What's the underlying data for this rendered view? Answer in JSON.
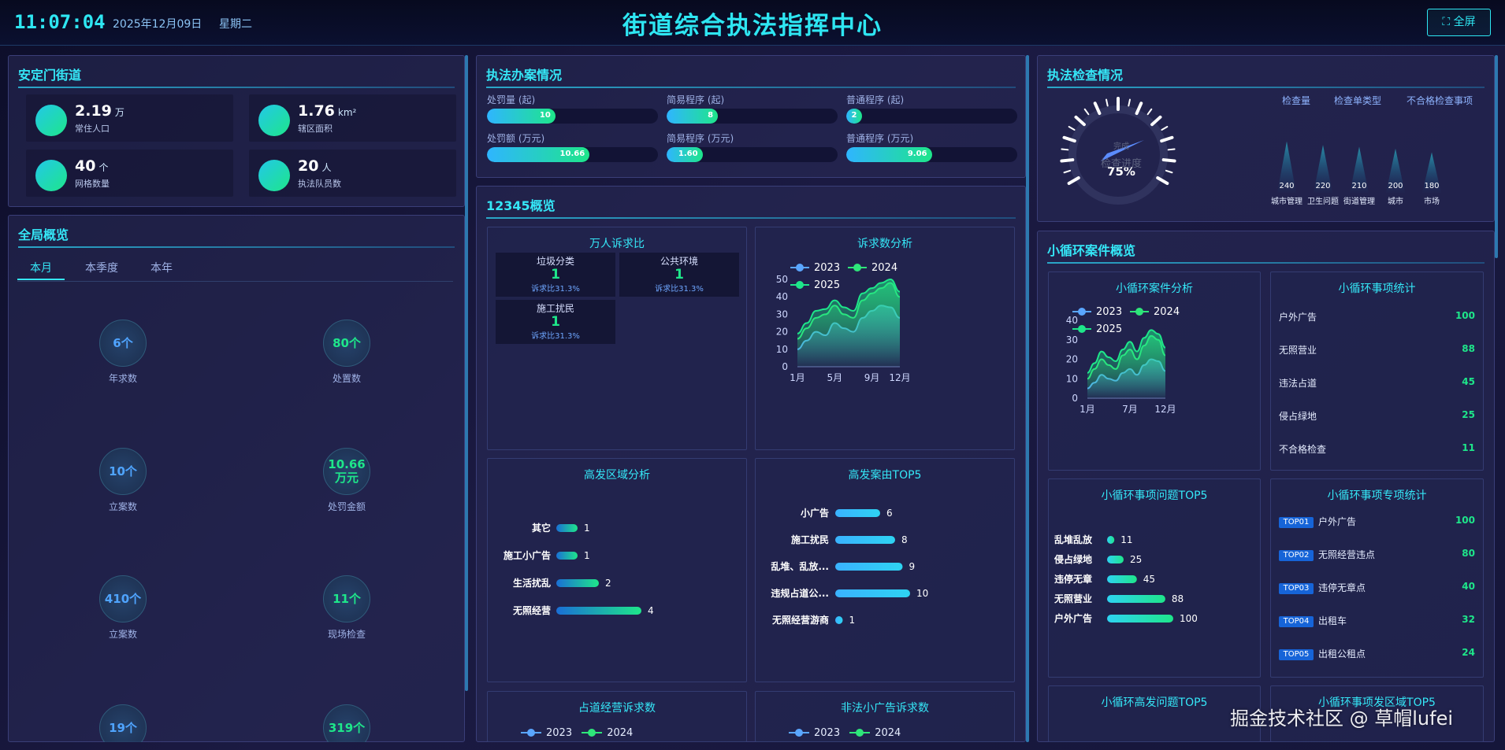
{
  "header": {
    "time": "11:07:04",
    "date": "2025年12月09日",
    "weekday": "星期二",
    "title": "街道综合执法指挥中心",
    "fullscreen_label": "⛶ 全屏"
  },
  "district": {
    "title": "安定门街道",
    "stats": [
      {
        "value": "2.19",
        "unit": "万",
        "label": "常住人口"
      },
      {
        "value": "1.76",
        "unit": "km²",
        "label": "辖区面积"
      },
      {
        "value": "40",
        "unit": "个",
        "label": "网格数量"
      },
      {
        "value": "20",
        "unit": "人",
        "label": "执法队员数"
      }
    ]
  },
  "overview": {
    "title": "全局概览",
    "tabs": [
      "本月",
      "本季度",
      "本年"
    ],
    "items": [
      {
        "value": "6个",
        "label": "年求数",
        "color": "blue"
      },
      {
        "value": "80个",
        "label": "处置数",
        "color": "green"
      },
      {
        "value": "10个",
        "label": "立案数",
        "color": "blue"
      },
      {
        "value": "10.66万元",
        "label": "处罚金额",
        "color": "green"
      },
      {
        "value": "410个",
        "label": "立案数",
        "color": "blue"
      },
      {
        "value": "11个",
        "label": "现场检查",
        "color": "green"
      },
      {
        "value": "19个",
        "label": "",
        "color": "blue"
      },
      {
        "value": "319个",
        "label": "",
        "color": "green"
      }
    ]
  },
  "cases": {
    "title": "执法办案情况",
    "rows": [
      {
        "label": "处罚量 (起)",
        "value": "10",
        "pct": 40
      },
      {
        "label": "简易程序 (起)",
        "value": "8",
        "pct": 30
      },
      {
        "label": "普通程序 (起)",
        "value": "2",
        "pct": 9
      },
      {
        "label": "处罚额 (万元)",
        "value": "10.66",
        "pct": 60
      },
      {
        "label": "简易程序 (万元)",
        "value": "1.60",
        "pct": 21
      },
      {
        "label": "普通程序 (万元)",
        "value": "9.06",
        "pct": 50
      }
    ]
  },
  "hotline": {
    "title": "12345概览",
    "ratio": {
      "title": "万人诉求比",
      "cards": [
        {
          "name": "垃圾分类",
          "value": "1",
          "ratio": "诉求比31.3%"
        },
        {
          "name": "公共环境",
          "value": "1",
          "ratio": "诉求比31.3%"
        },
        {
          "name": "施工扰民",
          "value": "1",
          "ratio": "诉求比31.3%"
        }
      ]
    },
    "trend": {
      "title": "诉求数分析"
    },
    "region": {
      "title": "高发区域分析"
    },
    "top5": {
      "title": "高发案由TOP5"
    },
    "road": {
      "title": "占道经营诉求数"
    },
    "ads": {
      "title": "非法小广告诉求数"
    }
  },
  "inspection": {
    "title": "执法检查情况",
    "gauge_value": "75%",
    "gauge_label": "检查进度",
    "gauge_sub": "完成",
    "metrics": [
      "检查量",
      "检查单类型",
      "不合格检查事项"
    ]
  },
  "loop": {
    "title": "小循环案件概览",
    "analysis": {
      "title": "小循环案件分析"
    },
    "stats": {
      "title": "小循环事项统计",
      "items": [
        {
          "name": "户外广告",
          "value": "100"
        },
        {
          "name": "无照营业",
          "value": "88"
        },
        {
          "name": "违法占道",
          "value": "45"
        },
        {
          "name": "侵占绿地",
          "value": "25"
        },
        {
          "name": "不合格检查",
          "value": "11"
        }
      ]
    },
    "issues": {
      "title": "小循环事项问题TOP5"
    },
    "special": {
      "title": "小循环事项专项统计",
      "items": [
        {
          "badge": "TOP01",
          "name": "户外广告",
          "value": "100"
        },
        {
          "badge": "TOP02",
          "name": "无照经营违点",
          "value": "80"
        },
        {
          "badge": "TOP03",
          "name": "违停无章点",
          "value": "40"
        },
        {
          "badge": "TOP04",
          "name": "出租车",
          "value": "32"
        },
        {
          "badge": "TOP05",
          "name": "出租公租点",
          "value": "24"
        }
      ]
    },
    "high_issue": {
      "title": "小循环高发问题TOP5"
    },
    "high_area": {
      "title": "小循环事项发区域TOP5"
    }
  },
  "watermark": "掘金技术社区 @ 草帽lufei",
  "chart_data": [
    {
      "type": "area",
      "title": "诉求数分析",
      "x": [
        "1月",
        "2月",
        "3月",
        "4月",
        "5月",
        "6月",
        "7月",
        "8月",
        "9月",
        "10月",
        "11月",
        "12月"
      ],
      "xticks": [
        "1月",
        "5月",
        "9月",
        "12月"
      ],
      "ylim": [
        0,
        50
      ],
      "yticks": [
        0,
        10,
        20,
        30,
        40,
        50
      ],
      "series": [
        {
          "name": "2023",
          "color": "#5aa6ff",
          "values": [
            10,
            15,
            20,
            18,
            25,
            22,
            20,
            28,
            32,
            35,
            34,
            28
          ]
        },
        {
          "name": "2024",
          "color": "#2ee67a",
          "values": [
            16,
            22,
            28,
            30,
            35,
            30,
            28,
            38,
            42,
            45,
            48,
            40
          ]
        },
        {
          "name": "2025",
          "color": "#1ee68a",
          "values": [
            19,
            25,
            32,
            33,
            38,
            34,
            32,
            42,
            45,
            48,
            50,
            43
          ]
        }
      ]
    },
    {
      "type": "bar",
      "title": "高发区域分析",
      "categories": [
        "其它",
        "施工小广告",
        "生活扰乱",
        "无照经营"
      ],
      "values": [
        1,
        1,
        2,
        4
      ]
    },
    {
      "type": "bar",
      "title": "高发案由TOP5",
      "categories": [
        "小广告",
        "施工扰民",
        "乱堆、乱放...",
        "违规占道公...",
        "无照经营游商"
      ],
      "values": [
        6,
        8,
        9,
        10,
        1
      ]
    },
    {
      "type": "bar",
      "title": "执法检查情况",
      "categories": [
        "城市管理",
        "卫生问题",
        "街道管理",
        "城市",
        "市场"
      ],
      "values": [
        240,
        220,
        210,
        200,
        180
      ]
    },
    {
      "type": "area",
      "title": "小循环案件分析",
      "x": [
        "1月",
        "2月",
        "3月",
        "4月",
        "5月",
        "6月",
        "7月",
        "8月",
        "9月",
        "10月",
        "11月",
        "12月"
      ],
      "xticks": [
        "1月",
        "7月",
        "12月"
      ],
      "ylim": [
        0,
        40
      ],
      "yticks": [
        0,
        10,
        20,
        30,
        40
      ],
      "series": [
        {
          "name": "2023",
          "color": "#5aa6ff",
          "values": [
            5,
            8,
            12,
            10,
            9,
            13,
            15,
            12,
            17,
            20,
            19,
            14
          ]
        },
        {
          "name": "2024",
          "color": "#2ee67a",
          "values": [
            10,
            15,
            20,
            17,
            15,
            22,
            25,
            20,
            27,
            32,
            30,
            22
          ]
        },
        {
          "name": "2025",
          "color": "#1ee68a",
          "values": [
            13,
            18,
            24,
            21,
            19,
            25,
            29,
            24,
            31,
            35,
            33,
            26
          ]
        }
      ]
    },
    {
      "type": "bar",
      "title": "小循环事项问题TOP5",
      "categories": [
        "乱堆乱放",
        "侵占绿地",
        "违停无章",
        "无照营业",
        "户外广告"
      ],
      "values": [
        11,
        25,
        45,
        88,
        100
      ]
    }
  ]
}
